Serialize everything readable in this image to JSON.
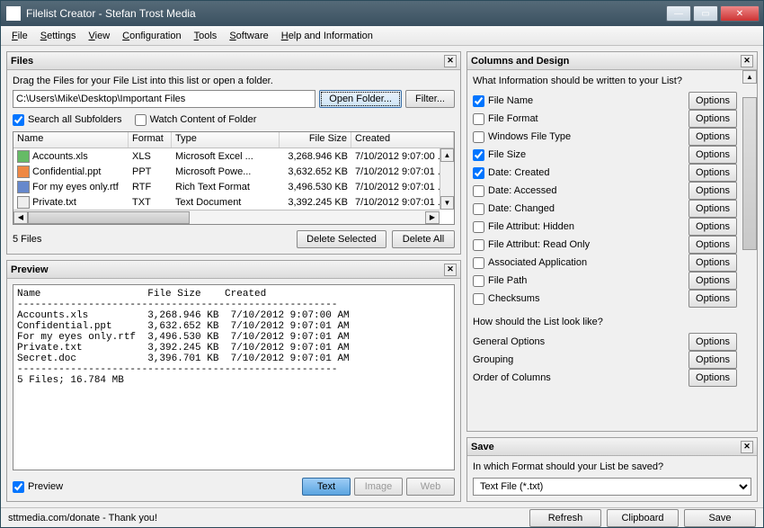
{
  "window": {
    "title": "Filelist Creator - Stefan Trost Media"
  },
  "menu": [
    "File",
    "Settings",
    "View",
    "Configuration",
    "Tools",
    "Software",
    "Help and Information"
  ],
  "files": {
    "title": "Files",
    "hint": "Drag the Files for your File List into this list or open a folder.",
    "path": "C:\\Users\\Mike\\Desktop\\Important Files",
    "open_btn": "Open Folder...",
    "filter_btn": "Filter...",
    "chk_subfolders": "Search all Subfolders",
    "chk_watch": "Watch Content of Folder",
    "cols": {
      "name": "Name",
      "format": "Format",
      "type": "Type",
      "size": "File Size",
      "created": "Created"
    },
    "rows": [
      {
        "icon": "xls",
        "name": "Accounts.xls",
        "format": "XLS",
        "type": "Microsoft Excel ...",
        "size": "3,268.946 KB",
        "created": "7/10/2012 9:07:00 ..."
      },
      {
        "icon": "ppt",
        "name": "Confidential.ppt",
        "format": "PPT",
        "type": "Microsoft Powe...",
        "size": "3,632.652 KB",
        "created": "7/10/2012 9:07:01 ..."
      },
      {
        "icon": "rtf",
        "name": "For my eyes only.rtf",
        "format": "RTF",
        "type": "Rich Text Format",
        "size": "3,496.530 KB",
        "created": "7/10/2012 9:07:01 ..."
      },
      {
        "icon": "txt",
        "name": "Private.txt",
        "format": "TXT",
        "type": "Text Document",
        "size": "3,392.245 KB",
        "created": "7/10/2012 9:07:01 ..."
      }
    ],
    "count": "5 Files",
    "delete_sel": "Delete Selected",
    "delete_all": "Delete All"
  },
  "preview": {
    "title": "Preview",
    "text": "Name                  File Size    Created\n------------------------------------------------------\nAccounts.xls          3,268.946 KB  7/10/2012 9:07:00 AM\nConfidential.ppt      3,632.652 KB  7/10/2012 9:07:01 AM\nFor my eyes only.rtf  3,496.530 KB  7/10/2012 9:07:01 AM\nPrivate.txt           3,392.245 KB  7/10/2012 9:07:01 AM\nSecret.doc            3,396.701 KB  7/10/2012 9:07:01 AM\n------------------------------------------------------\n5 Files; 16.784 MB",
    "chk": "Preview",
    "btn_text": "Text",
    "btn_image": "Image",
    "btn_web": "Web"
  },
  "design": {
    "title": "Columns and Design",
    "q1": "What Information should be written to your List?",
    "opts": [
      {
        "label": "File Name",
        "checked": true
      },
      {
        "label": "File Format",
        "checked": false
      },
      {
        "label": "Windows File Type",
        "checked": false
      },
      {
        "label": "File Size",
        "checked": true
      },
      {
        "label": "Date: Created",
        "checked": true
      },
      {
        "label": "Date: Accessed",
        "checked": false
      },
      {
        "label": "Date: Changed",
        "checked": false
      },
      {
        "label": "File Attribut: Hidden",
        "checked": false
      },
      {
        "label": "File Attribut: Read Only",
        "checked": false
      },
      {
        "label": "Associated Application",
        "checked": false
      },
      {
        "label": "File Path",
        "checked": false
      },
      {
        "label": "Checksums",
        "checked": false
      }
    ],
    "options_btn": "Options",
    "q2": "How should the List look like?",
    "extra": [
      "General Options",
      "Grouping",
      "Order of Columns"
    ]
  },
  "save": {
    "title": "Save",
    "q": "In which Format should your List be saved?",
    "format": "Text File (*.txt)"
  },
  "status": {
    "text": "sttmedia.com/donate - Thank you!",
    "refresh": "Refresh",
    "clipboard": "Clipboard",
    "save": "Save"
  }
}
